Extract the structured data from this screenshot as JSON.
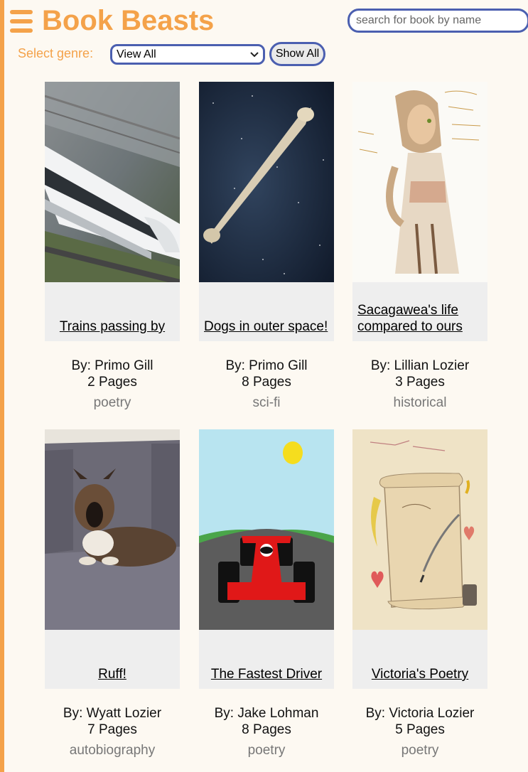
{
  "header": {
    "title": "Book Beasts",
    "menu_icon": "hamburger-menu-icon",
    "search_placeholder": "search for book by name"
  },
  "filter": {
    "label": "Select genre:",
    "selected_genre": "View All",
    "show_all_label": "Show All"
  },
  "colors": {
    "accent": "#f4a24a",
    "control_border": "#4b5fb0",
    "page_background": "#fdf9f2",
    "card_background": "#eeeeee",
    "genre_text": "#777777"
  },
  "books": [
    {
      "title": "Trains passing by",
      "author": "By: Primo Gill",
      "pages": "2 Pages",
      "genre": "poetry",
      "cover": "high-speed-train-photo"
    },
    {
      "title": "Dogs in outer space!",
      "author": "By: Primo Gill",
      "pages": "8 Pages",
      "genre": "sci-fi",
      "cover": "bone-in-starfield-image"
    },
    {
      "title": "Sacagawea's life compared to ours",
      "author": "By: Lillian Lozier",
      "pages": "3 Pages",
      "genre": "historical",
      "cover": "drawing-of-sacagawea"
    },
    {
      "title": "Ruff!",
      "author": "By: Wyatt Lozier",
      "pages": "7 Pages",
      "genre": "autobiography",
      "cover": "puppy-on-chair-photo"
    },
    {
      "title": "The Fastest Driver",
      "author": "By: Jake Lohman",
      "pages": "8 Pages",
      "genre": "poetry",
      "cover": "red-race-car-drawing"
    },
    {
      "title": "Victoria's Poetry",
      "author": "By: Victoria Lozier",
      "pages": "5 Pages",
      "genre": "poetry",
      "cover": "poetry-scroll-drawing"
    }
  ]
}
